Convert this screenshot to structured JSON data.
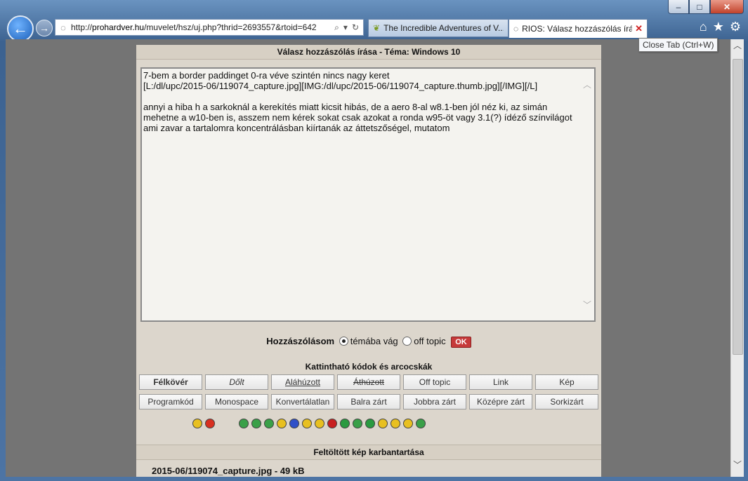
{
  "window": {
    "caption_buttons": {
      "minimize": "–",
      "maximize": "□",
      "close": "✕"
    }
  },
  "nav": {
    "address_url_prefix": "http://",
    "address_host": "prohardver.hu",
    "address_path": "/muvelet/hsz/uj.php?thrid=2693557&rtoid=642"
  },
  "tabs": [
    {
      "label": "The Incredible Adventures of V..."
    },
    {
      "label": "RIOS: Válasz hozzászólás írá..."
    }
  ],
  "tooltip": "Close Tab (Ctrl+W)",
  "form": {
    "title": "Válasz hozzászólás írása - Téma: Windows 10",
    "editor_text": "7-bem a border paddinget 0-ra véve szintén nincs nagy keret\n[L:/dl/upc/2015-06/119074_capture.jpg][IMG:/dl/upc/2015-06/119074_capture.thumb.jpg][/IMG][/L]\n\nannyi a hiba h a sarkoknál a kerekítés miatt kicsit hibás, de a aero 8-al w8.1-ben jól néz ki, az simán\nmehetne a w10-ben is, asszem nem kérek sokat csak azokat a ronda w95-öt vagy 3.1(?) ídéző színvilágot\nami zavar a tartalomra koncentrálásban kiírtanák az áttetszőségel, mutatom",
    "post_label": "Hozzászólásom",
    "option_thread": "témába vág",
    "option_offtopic": "off topic",
    "ok_label": "OK",
    "codes_title": "Kattintható kódok és arcocskák",
    "row1": [
      "Félkövér",
      "Dőlt",
      "Aláhúzott",
      "Áthúzott",
      "Off topic",
      "Link",
      "Kép"
    ],
    "row2": [
      "Programkód",
      "Monospace",
      "Konvertálatlan",
      "Balra zárt",
      "Jobbra zárt",
      "Középre zárt",
      "Sorkizárt"
    ],
    "uploads_title": "Feltöltött kép karbantartása",
    "upload_item": "2015-06/119074_capture.jpg - 49 kB"
  },
  "smiley_colors": [
    "#e8c020",
    "#d83020",
    "#3aa048",
    "#3aa048",
    "#3aa048",
    "#e8c020",
    "#3050c8",
    "#e8c020",
    "#e8c020",
    "#c82020",
    "#2a9a40",
    "#3aa048",
    "#2a9a40",
    "#e8c020",
    "#e8c020",
    "#e8c020",
    "#3aa048"
  ]
}
